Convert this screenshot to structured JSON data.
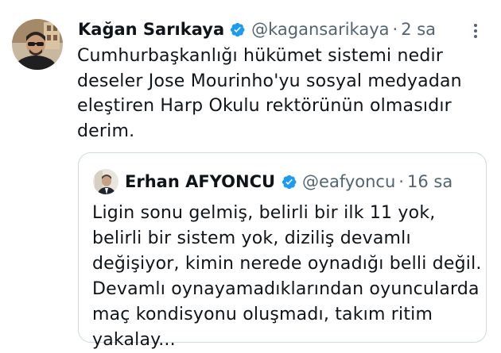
{
  "tweet": {
    "author_name": "Kağan Sarıkaya",
    "handle": "@kagansarikaya",
    "separator": "·",
    "time": "2 sa",
    "text": "Cumhurbaşkanlığı hükümet sistemi nedir deseler Jose Mourinho'yu sosyal medyadan eleştiren Harp Okulu rektörünün olmasıdır derim."
  },
  "quoted": {
    "author_name": "Erhan AFYONCU",
    "handle": "@eafyoncu",
    "separator": "·",
    "time": "16 sa",
    "text": "Ligin sonu gelmiş, belirli bir ilk 11 yok, belirli bir sistem yok, diziliş devamlı değişiyor, kimin nerede oynadığı belli değil. Devamlı oynayamadıklarından oyuncularda maç kondisyonu oluşmadı, takım ritim yakalay..."
  },
  "icons": {
    "verified": "verified-badge-icon",
    "more": "more-options-icon"
  },
  "colors": {
    "verified_blue": "#1d9bf0",
    "secondary_text": "#536471",
    "border": "#cfd9de"
  }
}
